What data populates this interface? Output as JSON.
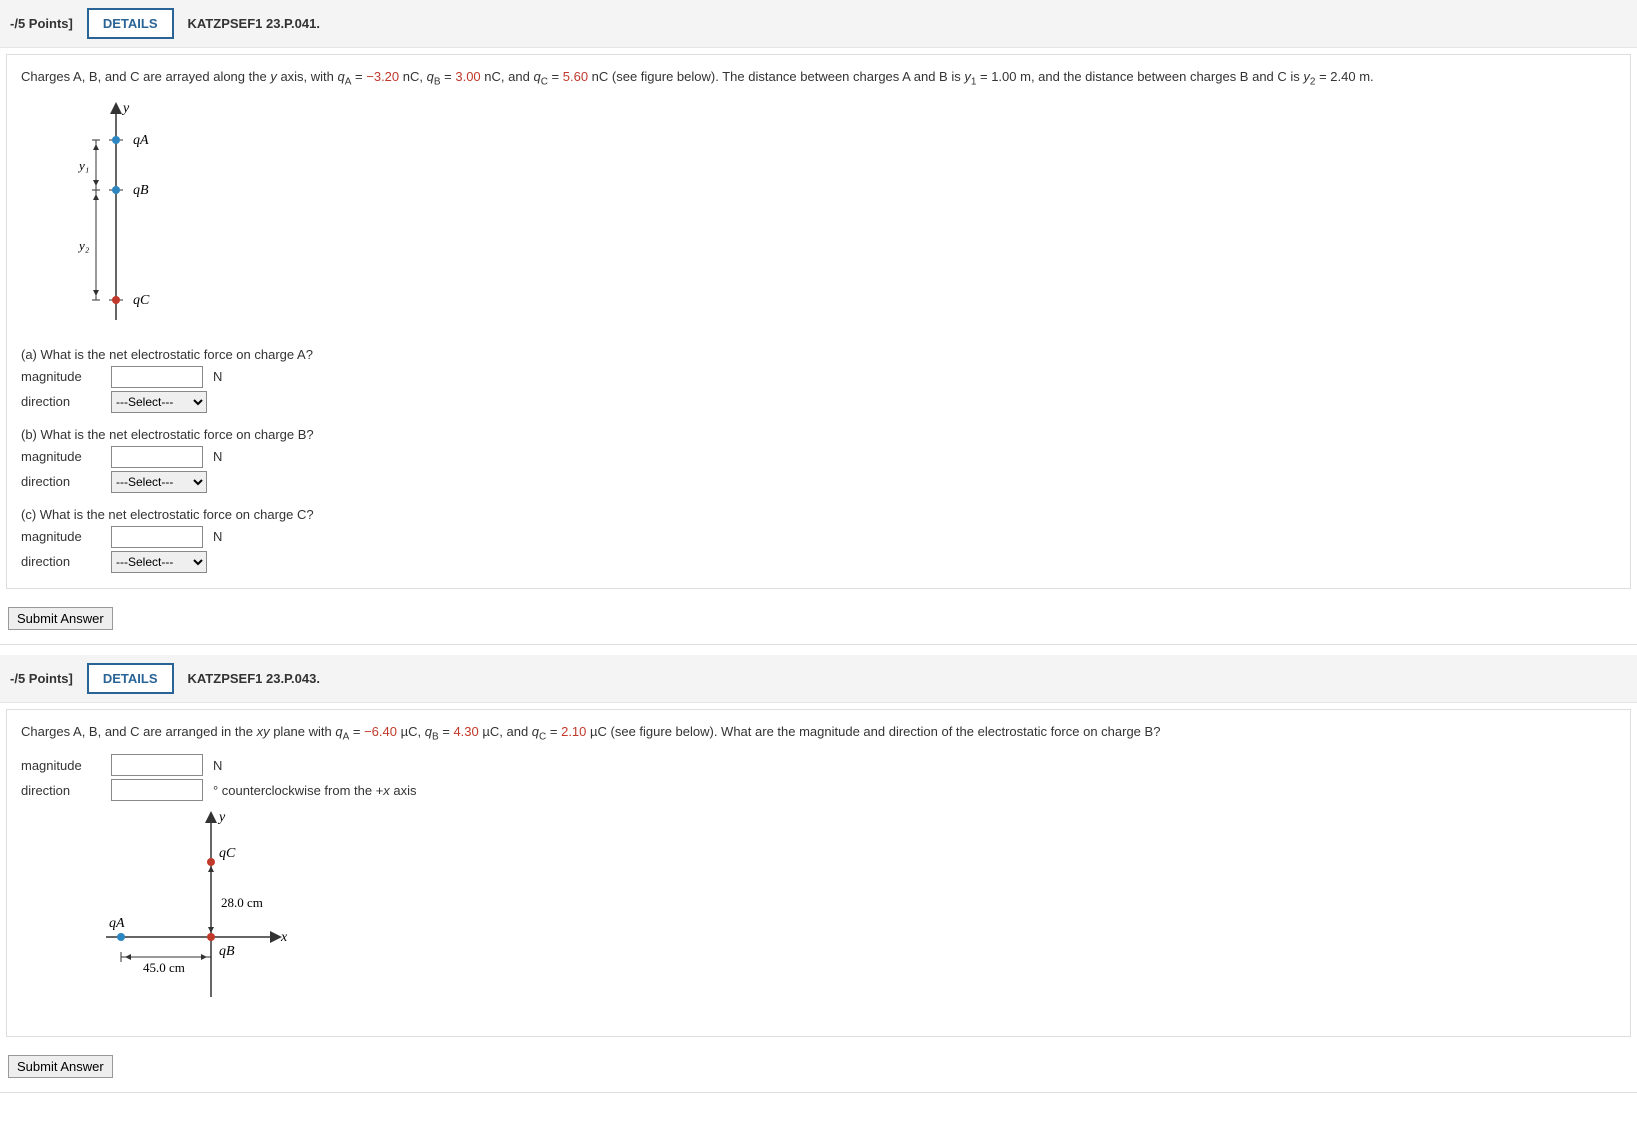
{
  "q1": {
    "points": "-/5 Points]",
    "details": "DETAILS",
    "source": "KATZPSEF1 23.P.041.",
    "prompt_pre": "Charges A, B, and C are arrayed along the ",
    "prompt_yaxis": "y",
    "prompt_with": " axis, with  ",
    "qA_lbl": "q",
    "qA_sub": "A",
    "eq": " = ",
    "qA_val": "−3.20",
    "nC": " nC,  ",
    "qB_sub": "B",
    "qB_val": "3.00",
    "qC_sub": "C",
    "and": "and  ",
    "qC_val": "5.60",
    "nC_end": " nC  (see figure below). The distance between charges A and B is  ",
    "y1_lbl": "y",
    "y1_sub": "1",
    "y1_val": " = 1.00 m,  and the distance between charges B and C is  ",
    "y2_sub": "2",
    "y2_val": " = 2.40 m.",
    "fig": {
      "y": "y",
      "qA": "qA",
      "qB": "qB",
      "qC": "qC",
      "y1": "y₁",
      "y2": "y₂"
    },
    "partA": "(a) What is the net electrostatic force on charge A?",
    "partB": "(b) What is the net electrostatic force on charge B?",
    "partC": "(c) What is the net electrostatic force on charge C?",
    "magnitude": "magnitude",
    "direction": "direction",
    "unitN": "N",
    "select": "---Select---",
    "submit": "Submit Answer"
  },
  "q2": {
    "points": "-/5 Points]",
    "details": "DETAILS",
    "source": "KATZPSEF1 23.P.043.",
    "prompt_pre": "Charges A, B, and C are arranged in the ",
    "xy": "xy",
    "plane": " plane with  ",
    "qA_val": "−6.40",
    "uC": " µC,  ",
    "qB_val": "4.30",
    "qC_val": "2.10",
    "uC_end": " µC  (see figure below). What are the magnitude and direction of the electrostatic force on charge B?",
    "magnitude": "magnitude",
    "direction": "direction",
    "unitN": "N",
    "deg_ccw": "° counterclockwise from the +",
    "x_axis": "x",
    "axis": " axis",
    "fig": {
      "y": "y",
      "x": "x",
      "qA": "qA",
      "qB": "qB",
      "qC": "qC",
      "d1": "45.0 cm",
      "d2": "28.0 cm"
    },
    "submit": "Submit Answer"
  }
}
